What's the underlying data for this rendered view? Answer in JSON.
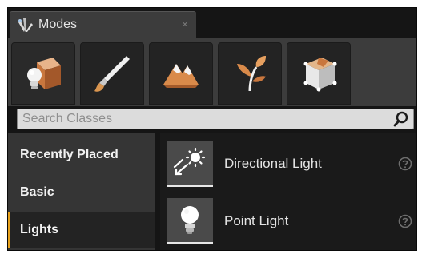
{
  "tab": {
    "title": "Modes",
    "close": "×"
  },
  "modes": [
    {
      "id": "place",
      "icon": "place-mode-icon",
      "active": true
    },
    {
      "id": "paint",
      "icon": "paint-brush-icon",
      "active": false
    },
    {
      "id": "landscape",
      "icon": "landscape-mountain-icon",
      "active": false
    },
    {
      "id": "foliage",
      "icon": "foliage-leaf-icon",
      "active": false
    },
    {
      "id": "geometry",
      "icon": "geometry-edit-icon",
      "active": false
    }
  ],
  "search": {
    "placeholder": "Search Classes"
  },
  "categories": [
    {
      "label": "Recently Placed",
      "selected": false
    },
    {
      "label": "Basic",
      "selected": false
    },
    {
      "label": "Lights",
      "selected": true
    }
  ],
  "items": [
    {
      "label": "Directional Light",
      "icon": "directional-light-icon"
    },
    {
      "label": "Point Light",
      "icon": "point-light-icon"
    }
  ],
  "colors": {
    "accent": "#e7a11c",
    "panel": "#3c3c3c",
    "dark": "#151515"
  }
}
